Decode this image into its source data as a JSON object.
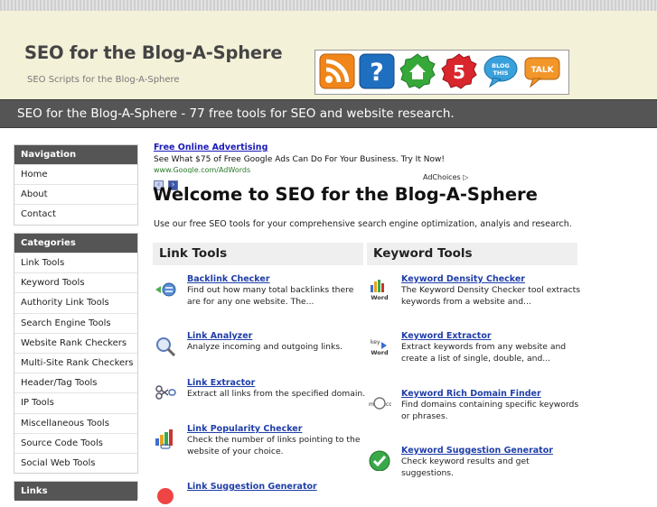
{
  "header": {
    "title": "SEO for the Blog-A-Sphere",
    "subtitle": "SEO Scripts for the Blog-A-Sphere",
    "icons": [
      "rss-icon",
      "help-icon",
      "home-icon",
      "badge-5-icon",
      "blog-this-icon",
      "talk-icon"
    ],
    "icon_labels": {
      "badge": "5",
      "blog": "BLOG THIS",
      "talk": "TALK"
    }
  },
  "tagline": "SEO for the Blog-A-Sphere - 77 free tools for SEO and website research.",
  "navigation": {
    "heading": "Navigation",
    "items": [
      "Home",
      "About",
      "Contact"
    ]
  },
  "categories": {
    "heading": "Categories",
    "items": [
      "Link Tools",
      "Keyword Tools",
      "Authority Link Tools",
      "Search Engine Tools",
      "Website Rank Checkers",
      "Multi-Site Rank Checkers",
      "Header/Tag Tools",
      "IP Tools",
      "Miscellaneous Tools",
      "Source Code Tools",
      "Social Web Tools"
    ]
  },
  "links_box": {
    "heading": "Links"
  },
  "ad": {
    "link": "Free Online Advertising",
    "text": "See What $75 of Free Google Ads Can Do For Your Business. Try It Now!",
    "url": "www.Google.com/AdWords",
    "choices": "AdChoices"
  },
  "main": {
    "heading": "Welcome to SEO for the Blog-A-Sphere",
    "intro": "Use our free SEO tools for your comprehensive search engine optimization, analyis and research."
  },
  "link_tools": {
    "heading": "Link Tools",
    "tools": [
      {
        "title": "Backlink Checker",
        "desc": "Find out how many total backlinks there are for any one website. The..."
      },
      {
        "title": "Link Analyzer",
        "desc": "Analyze incoming and outgoing links."
      },
      {
        "title": "Link Extractor",
        "desc": "Extract all links from the specified domain."
      },
      {
        "title": "Link Popularity Checker",
        "desc": "Check the number of links pointing to the website of your choice."
      },
      {
        "title": "Link Suggestion Generator",
        "desc": ""
      }
    ]
  },
  "keyword_tools": {
    "heading": "Keyword Tools",
    "tools": [
      {
        "title": "Keyword Density Checker",
        "desc": "The Keyword Density Checker tool extracts keywords from a website and..."
      },
      {
        "title": "Keyword Extractor",
        "desc": "Extract keywords from any website and create a list of single, double, and..."
      },
      {
        "title": "Keyword Rich Domain Finder",
        "desc": "Find domains containing specific keywords or phrases."
      },
      {
        "title": "Keyword Suggestion Generator",
        "desc": "Check keyword results and get suggestions."
      }
    ]
  },
  "colors": {
    "header_bg": "#f4f1d9",
    "bar_bg": "#555555",
    "link": "#1f3ea8",
    "panel_head": "#efefef"
  }
}
